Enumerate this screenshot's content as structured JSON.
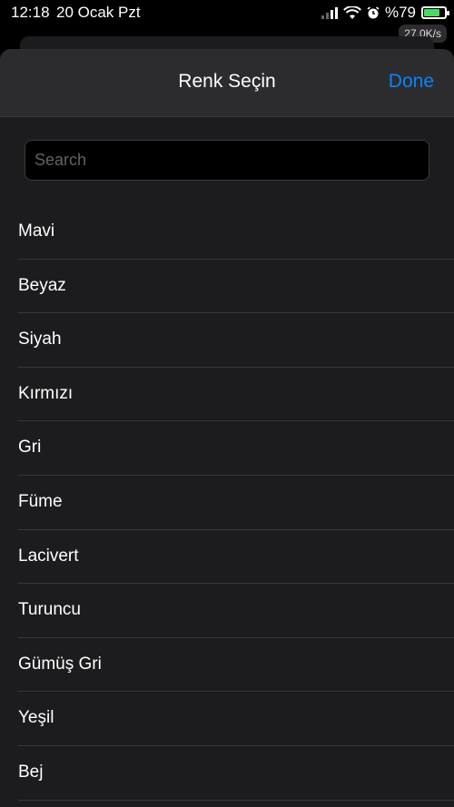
{
  "status_bar": {
    "time": "12:18",
    "date": "20 Ocak Pzt",
    "battery_label": "%79",
    "battery_level": 0.79,
    "network_speed": "27.0K/s"
  },
  "sheet": {
    "title": "Renk Seçin",
    "done_label": "Done"
  },
  "search": {
    "placeholder": "Search",
    "value": ""
  },
  "colors": [
    "Mavi",
    "Beyaz",
    "Siyah",
    "Kırmızı",
    "Gri",
    "Füme",
    "Lacivert",
    "Turuncu",
    "Gümüş Gri",
    "Yeşil",
    "Bej"
  ],
  "accent_color": "#0a84ff"
}
